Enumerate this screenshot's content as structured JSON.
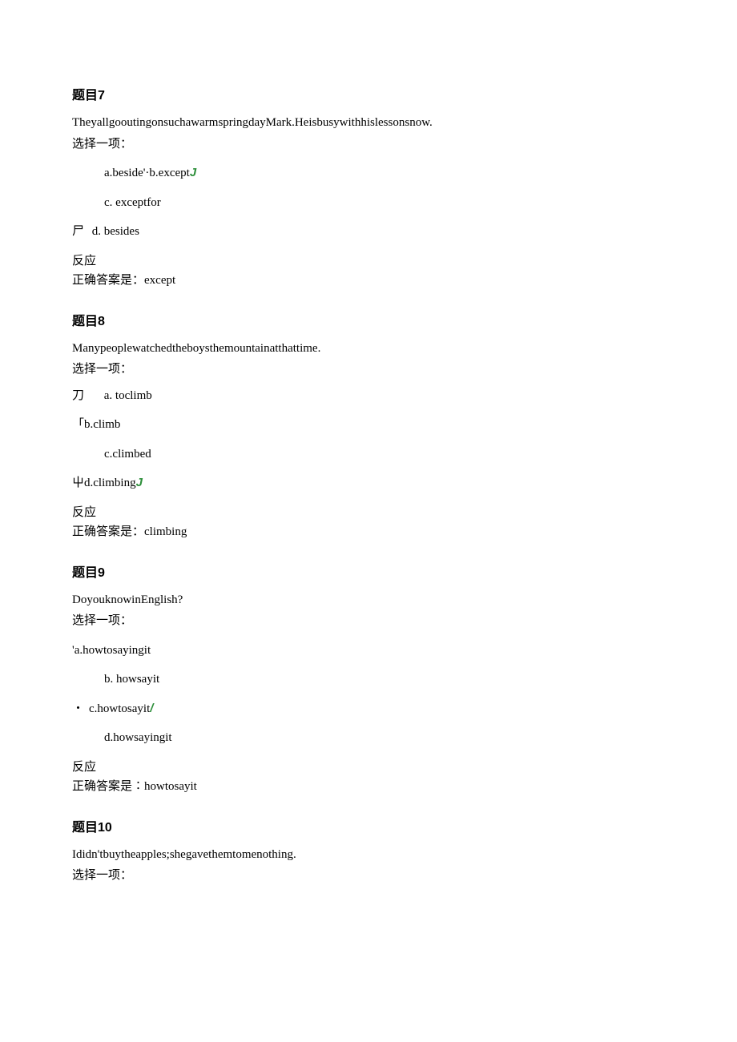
{
  "q7": {
    "heading_label": "题目",
    "heading_num": "7",
    "question": "TheyallgooutingonsuchawarmspringdayMark.Heisbusywithhislessonsnow.",
    "prompt": "选择一项：",
    "opt_ab": "a.beside'·b.except",
    "opt_c": "c.   exceptfor",
    "marker": "尸",
    "opt_d": "d.   besides",
    "feedback": "反应",
    "answer_label": "正确答案是：",
    "answer_value": "except"
  },
  "q8": {
    "heading_label": "题目",
    "heading_num": "8",
    "question": "Manypeoplewatchedtheboysthemountainatthattime.",
    "prompt": "选择一项：",
    "marker_a": "刀",
    "opt_a": "a.   toclimb",
    "opt_b_marker": "「",
    "opt_b": "b.climb",
    "opt_c": "c.climbed",
    "opt_d_marker": "屮",
    "opt_d": "d.climbing",
    "feedback": "反应",
    "answer_label": "正确答案是：",
    "answer_value": "climbing"
  },
  "q9": {
    "heading_label": "题目",
    "heading_num": "9",
    "question": "DoyouknowinEnglish?",
    "prompt": "选择一项：",
    "opt_a": "'a.howtosayingit",
    "opt_b": "b.   howsayit",
    "opt_c_bullet": "・",
    "opt_c": "c.howtosayit",
    "opt_d": "d.howsayingit",
    "feedback": "反应",
    "answer_label": "正确答案是∶",
    "answer_value": "howtosayit"
  },
  "q10": {
    "heading_label": "题目",
    "heading_num": "10",
    "question": "Ididn'tbuytheapples;shegavethemtomenothing.",
    "prompt": "选择一项："
  }
}
